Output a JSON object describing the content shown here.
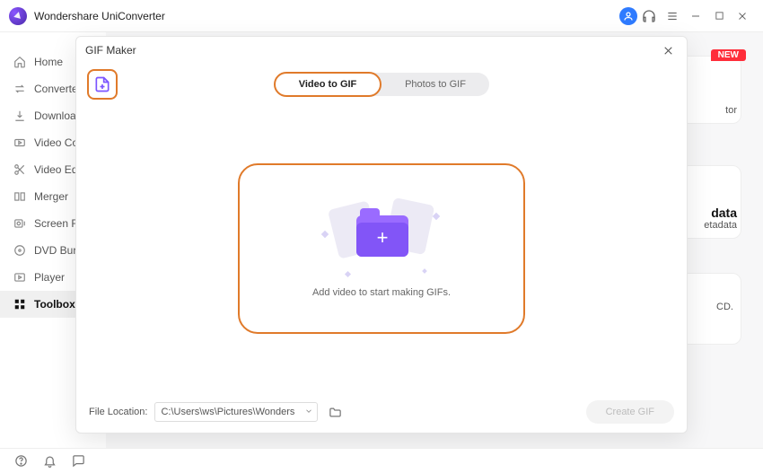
{
  "app": {
    "name": "Wondershare UniConverter"
  },
  "sidebar": {
    "items": [
      {
        "label": "Home"
      },
      {
        "label": "Converter"
      },
      {
        "label": "Downloader"
      },
      {
        "label": "Video Compressor"
      },
      {
        "label": "Video Editor"
      },
      {
        "label": "Merger"
      },
      {
        "label": "Screen Recorder"
      },
      {
        "label": "DVD Burner"
      },
      {
        "label": "Player"
      },
      {
        "label": "Toolbox"
      }
    ]
  },
  "cards": {
    "new_badge": "NEW",
    "c1_suffix": "tor",
    "c2_title": "data",
    "c2_sub": "etadata",
    "c3_text": "CD."
  },
  "modal": {
    "title": "GIF Maker",
    "tab_video": "Video to GIF",
    "tab_photo": "Photos to GIF",
    "drop_text": "Add video to start making GIFs.",
    "file_location_label": "File Location:",
    "file_location_value": "C:\\Users\\ws\\Pictures\\Wonders",
    "create_label": "Create GIF"
  }
}
